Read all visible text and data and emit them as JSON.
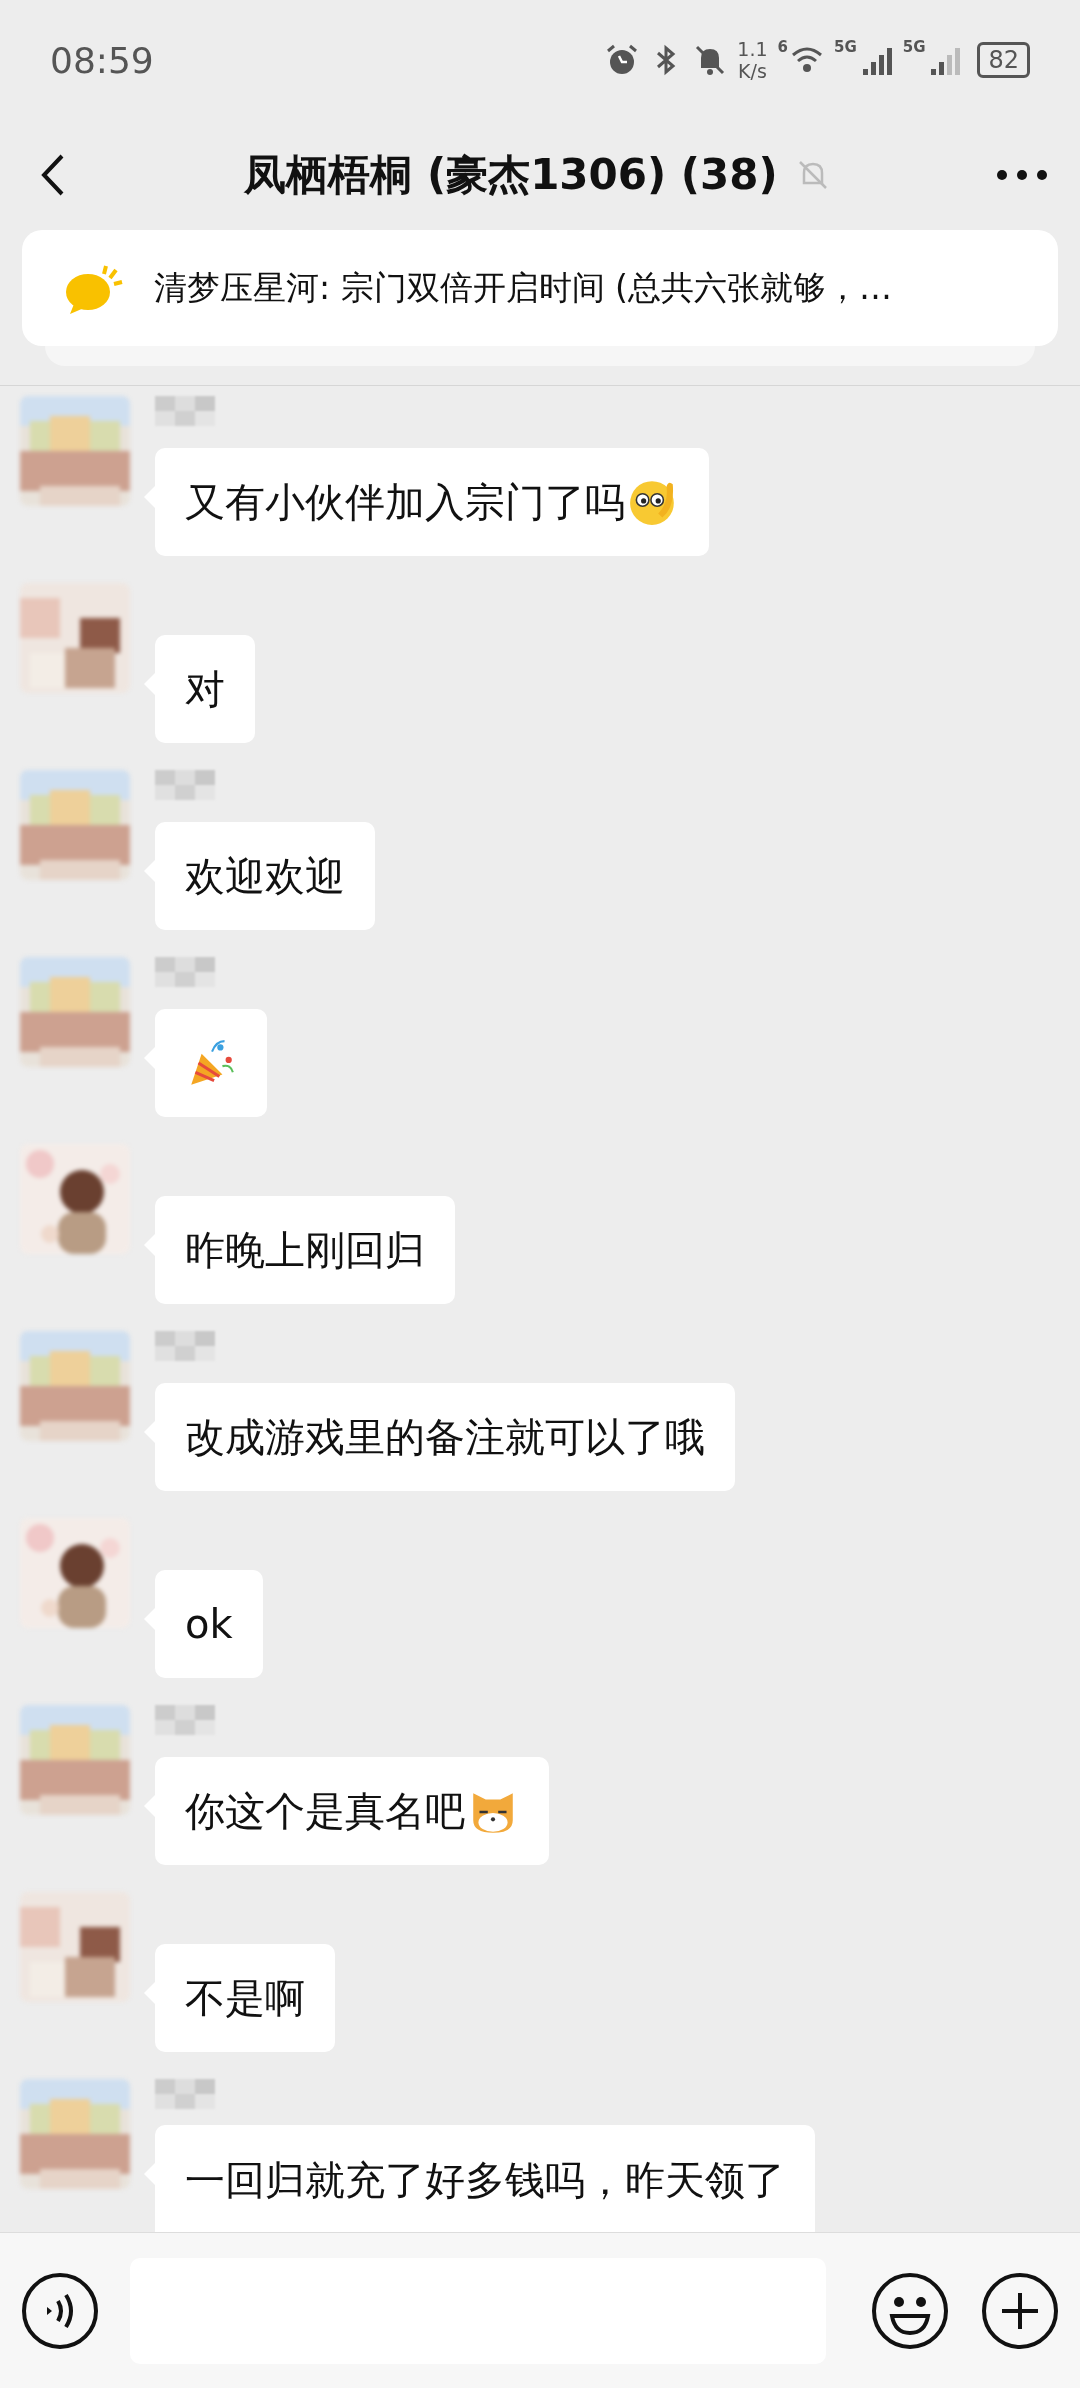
{
  "status_bar": {
    "time": "08:59",
    "net_speed": [
      "1.1",
      "K/s"
    ],
    "wifi_label": "6",
    "sim_labels": [
      "5G",
      "5G"
    ],
    "battery": "82"
  },
  "header": {
    "title": "凤栖梧桐 (豪杰1306) (38)",
    "muted": true
  },
  "pinned_notice": {
    "text": "清梦压星河: 宗门双倍开启时间 (总共六张就够，…"
  },
  "messages": [
    {
      "avatar": {
        "kind": "scenery"
      },
      "name_mosaic": true,
      "text": "又有小伙伴加入宗门了吗",
      "emoji": {
        "kind": "face"
      }
    },
    {
      "avatar": {
        "kind": "blur"
      },
      "name_mosaic": false,
      "text": "对"
    },
    {
      "avatar": {
        "kind": "scenery"
      },
      "name_mosaic": true,
      "text": "欢迎欢迎"
    },
    {
      "avatar": {
        "kind": "scenery"
      },
      "name_mosaic": true,
      "emoji": {
        "kind": "party"
      }
    },
    {
      "avatar": {
        "kind": "figure"
      },
      "name_mosaic": false,
      "text": "昨晚上刚回归"
    },
    {
      "avatar": {
        "kind": "scenery"
      },
      "name_mosaic": true,
      "text": "改成游戏里的备注就可以了哦"
    },
    {
      "avatar": {
        "kind": "figure"
      },
      "name_mosaic": false,
      "text": "ok"
    },
    {
      "avatar": {
        "kind": "scenery"
      },
      "name_mosaic": true,
      "text": "你这个是真名吧",
      "emoji": {
        "kind": "cat"
      }
    },
    {
      "avatar": {
        "kind": "blur"
      },
      "name_mosaic": false,
      "text": "不是啊"
    },
    {
      "avatar": {
        "kind": "scenery"
      },
      "name_mosaic": true,
      "text": "一回归就充了好多钱吗，昨天领了",
      "cut": true
    }
  ]
}
